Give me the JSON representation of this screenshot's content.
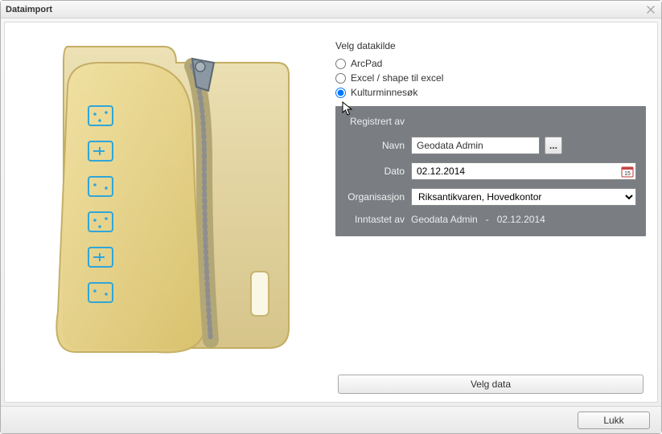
{
  "window": {
    "title": "Dataimport"
  },
  "datasource": {
    "section_label": "Velg datakilde",
    "options": {
      "arcpad": "ArcPad",
      "excel": "Excel / shape til excel",
      "kulturminnesok": "Kulturminnesøk"
    },
    "selected": "kulturminnesok"
  },
  "panel": {
    "title": "Registrert av",
    "navn_label": "Navn",
    "navn_value": "Geodata Admin",
    "browse_label": "...",
    "dato_label": "Dato",
    "dato_value": "02.12.2014",
    "organisasjon_label": "Organisasjon",
    "organisasjon_value": "Riksantikvaren, Hovedkontor",
    "inntastet_label": "Inntastet av",
    "inntastet_user": "Geodata Admin",
    "inntastet_sep": "-",
    "inntastet_date": "02.12.2014"
  },
  "buttons": {
    "velg_data": "Velg data",
    "lukk": "Lukk"
  }
}
